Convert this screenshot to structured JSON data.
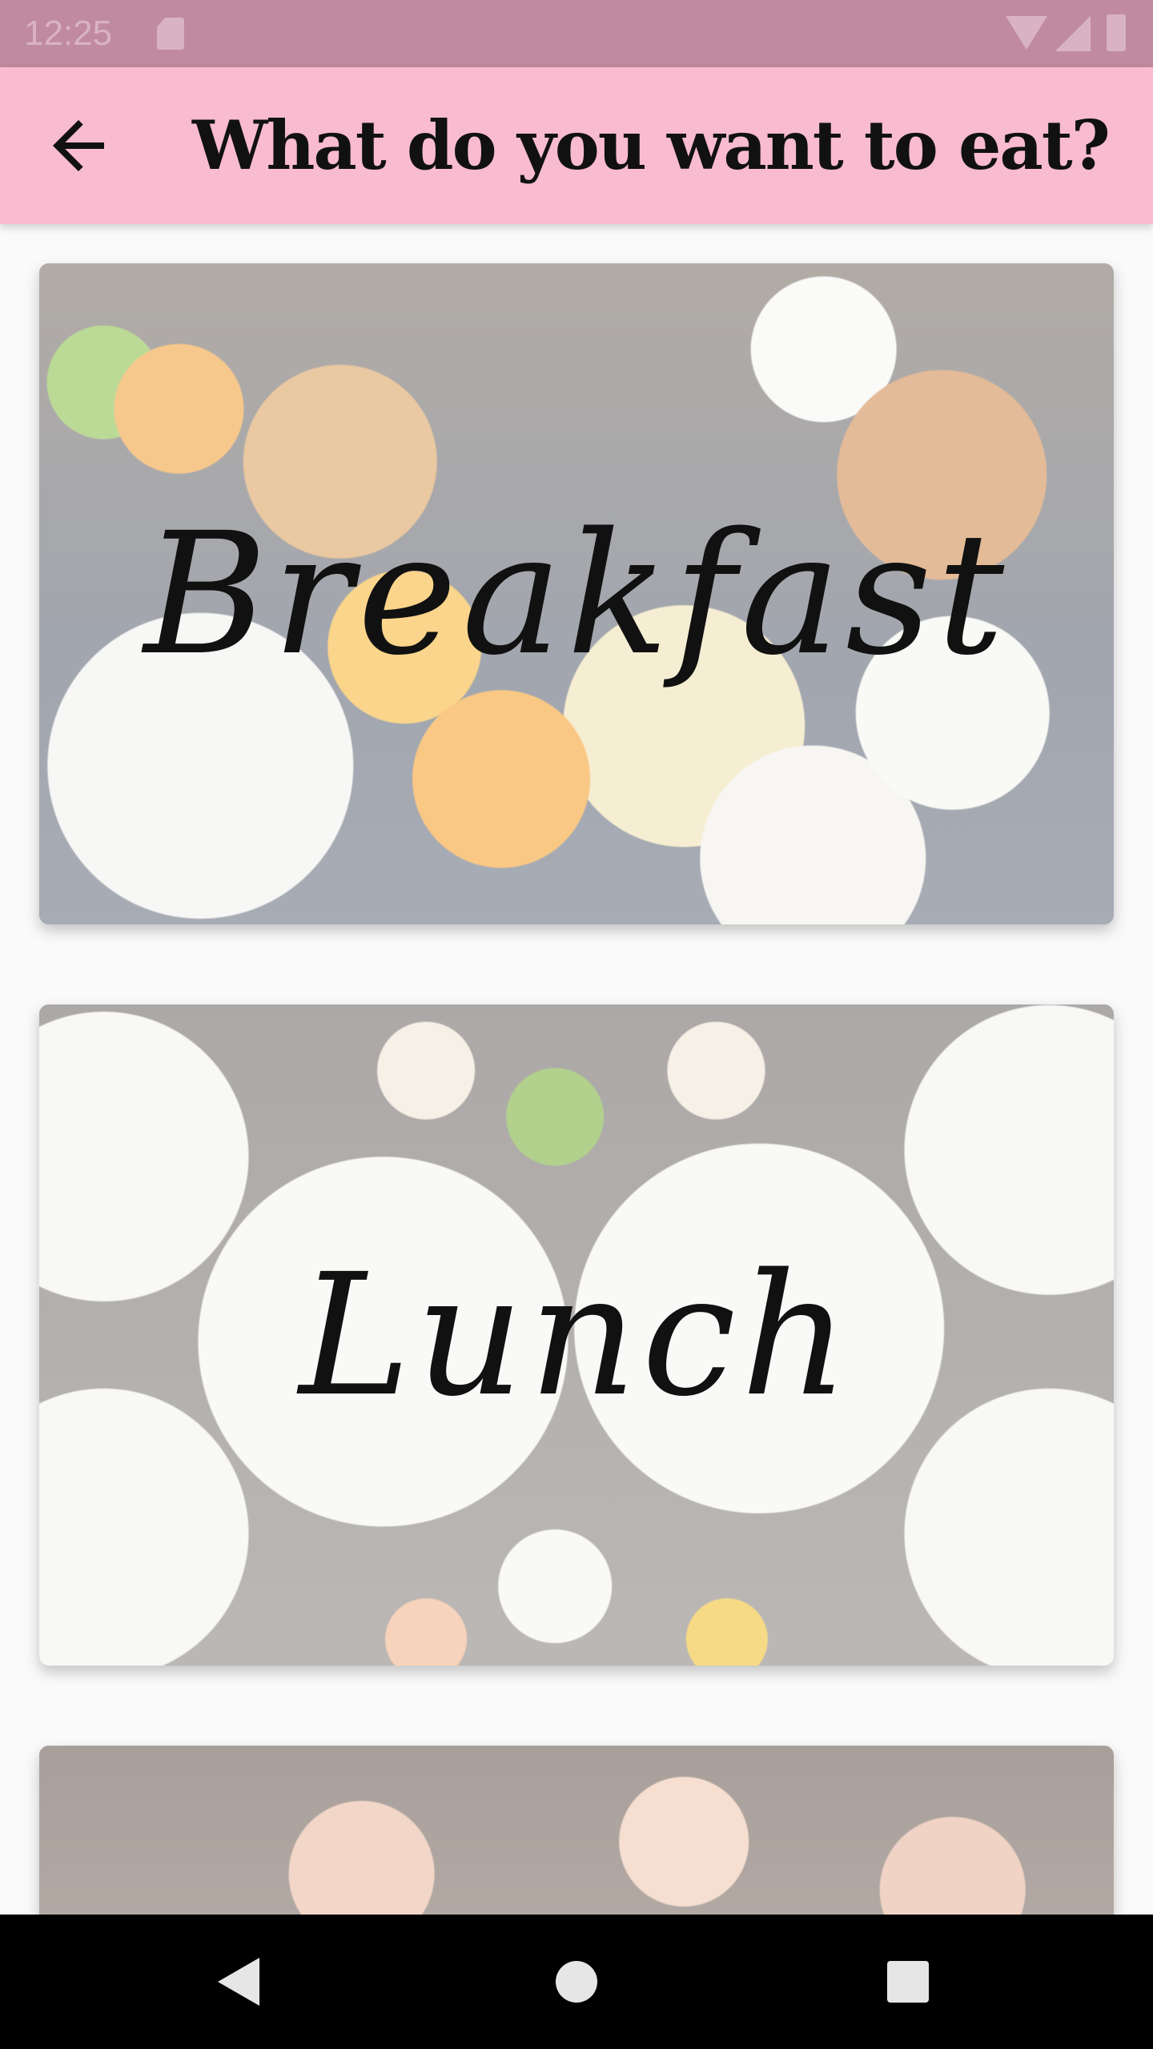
{
  "status_bar": {
    "time": "12:25",
    "icons": [
      "sd-card-icon",
      "wifi-icon",
      "signal-icon",
      "battery-icon"
    ]
  },
  "app_bar": {
    "title": "What do you want to eat?",
    "back_icon": "arrow-left-icon",
    "background_color": "#f8bbd0"
  },
  "meals": [
    {
      "label": "Breakfast"
    },
    {
      "label": "Lunch"
    },
    {
      "label": ""
    }
  ],
  "nav_bar": {
    "icons": [
      "nav-back-icon",
      "nav-home-icon",
      "nav-recents-icon"
    ]
  }
}
